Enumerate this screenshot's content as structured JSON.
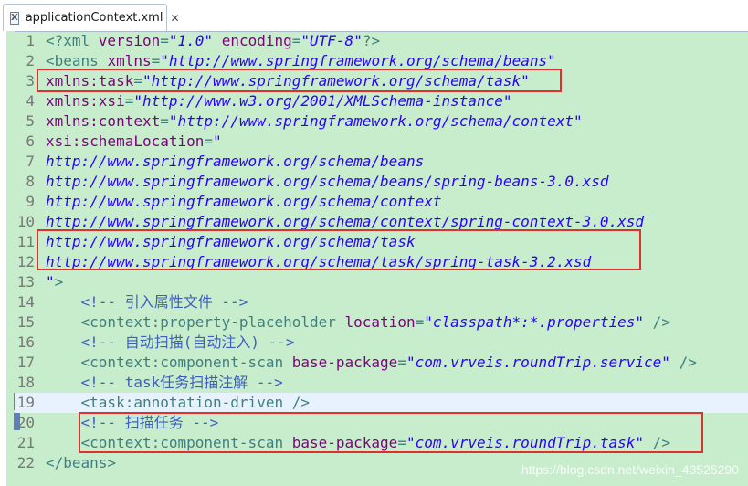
{
  "tab": {
    "icon": "xml-file-icon",
    "title": "applicationContext.xml",
    "close": "✕"
  },
  "lines": [
    {
      "n": "1",
      "parts": [
        [
          "t",
          "<?xml "
        ],
        [
          "a",
          "version"
        ],
        [
          "t",
          "="
        ],
        [
          "v",
          "\"1.0\""
        ],
        [
          "t",
          " "
        ],
        [
          "a",
          "encoding"
        ],
        [
          "t",
          "="
        ],
        [
          "v",
          "\"UTF-8\""
        ],
        [
          "t",
          "?>"
        ]
      ]
    },
    {
      "n": "2",
      "fold": "⊖",
      "parts": [
        [
          "t",
          "<beans "
        ],
        [
          "a",
          "xmlns"
        ],
        [
          "t",
          "="
        ],
        [
          "v",
          "\"http://www.springframework.org/schema/beans\""
        ]
      ]
    },
    {
      "n": "3",
      "parts": [
        [
          "a",
          "xmlns:task"
        ],
        [
          "t",
          "="
        ],
        [
          "v",
          "\"http://www.springframework.org/schema/task\""
        ]
      ]
    },
    {
      "n": "4",
      "parts": [
        [
          "a",
          "xmlns:xsi"
        ],
        [
          "t",
          "="
        ],
        [
          "v",
          "\"http://www.w3.org/2001/XMLSchema-instance\""
        ]
      ]
    },
    {
      "n": "5",
      "parts": [
        [
          "a",
          "xmlns:context"
        ],
        [
          "t",
          "="
        ],
        [
          "v",
          "\"http://www.springframework.org/schema/context\""
        ]
      ]
    },
    {
      "n": "6",
      "parts": [
        [
          "a",
          "xsi:schemaLocation"
        ],
        [
          "t",
          "="
        ],
        [
          "v",
          "\""
        ]
      ]
    },
    {
      "n": "7",
      "parts": [
        [
          "v",
          "http://www.springframework.org/schema/beans"
        ]
      ]
    },
    {
      "n": "8",
      "parts": [
        [
          "v",
          "http://www.springframework.org/schema/beans/spring-beans-3.0.xsd"
        ]
      ]
    },
    {
      "n": "9",
      "parts": [
        [
          "v",
          "http://www.springframework.org/schema/context"
        ]
      ]
    },
    {
      "n": "10",
      "parts": [
        [
          "v",
          "http://www.springframework.org/schema/context/spring-context-3.0.xsd"
        ]
      ]
    },
    {
      "n": "11",
      "parts": [
        [
          "v",
          "http://www.springframework.org/schema/task"
        ]
      ]
    },
    {
      "n": "12",
      "parts": [
        [
          "v",
          "http://www.springframework.org/schema/task/spring-task-3.2.xsd"
        ]
      ]
    },
    {
      "n": "13",
      "parts": [
        [
          "v",
          "\""
        ],
        [
          "t",
          ">"
        ]
      ]
    },
    {
      "n": "14",
      "parts": [
        [
          "t",
          "    "
        ],
        [
          "c",
          "<!-- 引入属性文件 -->"
        ]
      ]
    },
    {
      "n": "15",
      "parts": [
        [
          "t",
          "    <context:property-placeholder "
        ],
        [
          "a",
          "location"
        ],
        [
          "t",
          "="
        ],
        [
          "v",
          "\"classpath*:*.properties\""
        ],
        [
          "t",
          " />"
        ]
      ]
    },
    {
      "n": "16",
      "parts": [
        [
          "t",
          "    "
        ],
        [
          "c",
          "<!-- 自动扫描(自动注入) -->"
        ]
      ]
    },
    {
      "n": "17",
      "parts": [
        [
          "t",
          "    <context:component-scan "
        ],
        [
          "a",
          "base-package"
        ],
        [
          "t",
          "="
        ],
        [
          "v",
          "\"com.vrveis.roundTrip.service\""
        ],
        [
          "t",
          " />"
        ]
      ]
    },
    {
      "n": "18",
      "parts": [
        [
          "t",
          "    "
        ],
        [
          "c",
          "<!-- task任务扫描注解 -->"
        ]
      ]
    },
    {
      "n": "19",
      "current": true,
      "parts": [
        [
          "t",
          "    <task:annotation-driven />"
        ]
      ]
    },
    {
      "n": "20",
      "parts": [
        [
          "t",
          "    "
        ],
        [
          "c",
          "<!-- 扫描任务 -->"
        ]
      ]
    },
    {
      "n": "21",
      "parts": [
        [
          "t",
          "    <context:component-scan "
        ],
        [
          "a",
          "base-package"
        ],
        [
          "t",
          "="
        ],
        [
          "v",
          "\"com.vrveis.roundTrip.task\""
        ],
        [
          "t",
          " />"
        ]
      ]
    },
    {
      "n": "22",
      "parts": [
        [
          "t",
          "</beans>"
        ]
      ]
    }
  ],
  "highlight_boxes": [
    "line-3",
    "lines-11-12",
    "lines-20-21"
  ],
  "watermark": "https://blog.csdn.net/weixin_43525290",
  "colors": {
    "background": "#c7edcc",
    "tag": "#3f7f7f",
    "attribute": "#7f007f",
    "value": "#2a00ff",
    "comment": "#3f5fbf",
    "highlight_box": "#e0302c",
    "current_line": "#e8f2fe"
  }
}
